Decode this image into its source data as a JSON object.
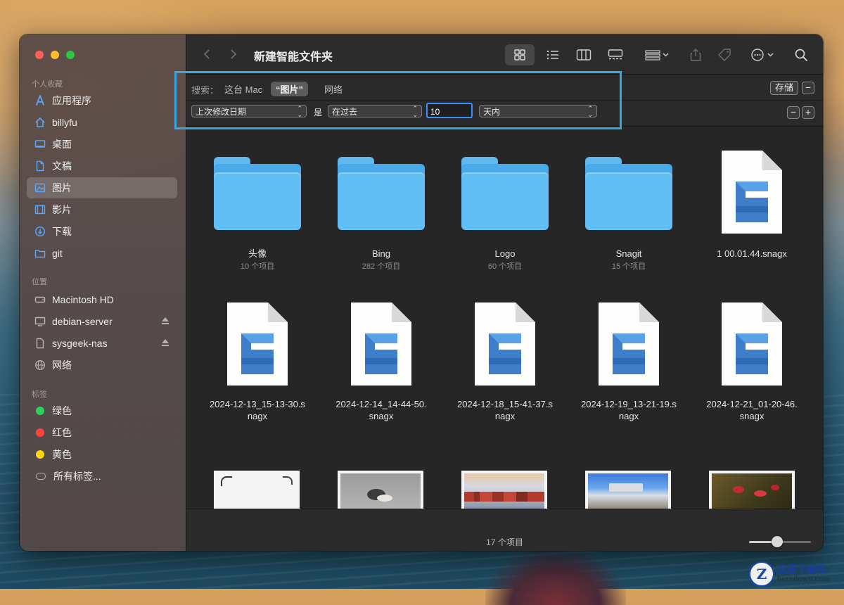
{
  "window": {
    "title": "新建智能文件夹"
  },
  "sidebar": {
    "sections": {
      "favorites": "个人收藏",
      "locations": "位置",
      "tags": "标签"
    },
    "favorites": [
      {
        "label": "应用程序",
        "icon": "applications-icon"
      },
      {
        "label": "billyfu",
        "icon": "home-icon"
      },
      {
        "label": "桌面",
        "icon": "desktop-icon"
      },
      {
        "label": "文稿",
        "icon": "document-icon"
      },
      {
        "label": "图片",
        "icon": "pictures-icon",
        "selected": true
      },
      {
        "label": "影片",
        "icon": "movies-icon"
      },
      {
        "label": "下载",
        "icon": "downloads-icon"
      },
      {
        "label": "git",
        "icon": "folder-icon"
      }
    ],
    "locations": [
      {
        "label": "Macintosh HD",
        "icon": "disk-icon"
      },
      {
        "label": "debian-server",
        "icon": "server-icon",
        "eject": true
      },
      {
        "label": "sysgeek-nas",
        "icon": "document-icon",
        "eject": true
      },
      {
        "label": "网络",
        "icon": "network-icon"
      }
    ],
    "tags": [
      {
        "label": "绿色",
        "color": "#30d158"
      },
      {
        "label": "红色",
        "color": "#ff453a"
      },
      {
        "label": "黄色",
        "color": "#ffd60a"
      },
      {
        "label": "所有标签...",
        "color": ""
      }
    ]
  },
  "toolbar": {
    "view_modes": [
      "icon-view",
      "list-view",
      "column-view",
      "gallery-view"
    ],
    "active_view": "icon-view"
  },
  "search_scope": {
    "label": "搜索：",
    "options": [
      "这台 Mac",
      "“图片”",
      "网络"
    ],
    "selected": "“图片”",
    "save_label": "存储"
  },
  "criteria": {
    "attribute": "上次修改日期",
    "is_label": "是",
    "operator": "在过去",
    "value": "10",
    "unit": "天内"
  },
  "items": [
    {
      "type": "folder",
      "name": "头像",
      "sub": "10 个项目"
    },
    {
      "type": "folder",
      "name": "Bing",
      "sub": "282 个项目"
    },
    {
      "type": "folder",
      "name": "Logo",
      "sub": "60 个项目"
    },
    {
      "type": "folder",
      "name": "Snagit",
      "sub": "15 个项目"
    },
    {
      "type": "snagx",
      "name_line1": "1 00.01.44.snagx",
      "name_line2": ""
    },
    {
      "type": "snagx",
      "name_line1": "2024-12-13_15-13-30.s",
      "name_line2": "nagx"
    },
    {
      "type": "snagx",
      "name_line1": "2024-12-14_14-44-50.",
      "name_line2": "snagx"
    },
    {
      "type": "snagx",
      "name_line1": "2024-12-18_15-41-37.s",
      "name_line2": "nagx"
    },
    {
      "type": "snagx",
      "name_line1": "2024-12-19_13-21-19.s",
      "name_line2": "nagx"
    },
    {
      "type": "snagx",
      "name_line1": "2024-12-21_01-20-46.",
      "name_line2": "snagx"
    }
  ],
  "thumbnails": [
    "blank-image",
    "bird-photo",
    "village-photo",
    "city-photo",
    "flower-photo"
  ],
  "status": {
    "count_text": "17 个项目",
    "zoom": 0.45
  },
  "watermark": {
    "main": "这里下载站",
    "sub": "heredown.com",
    "logo_letter": "Z"
  }
}
